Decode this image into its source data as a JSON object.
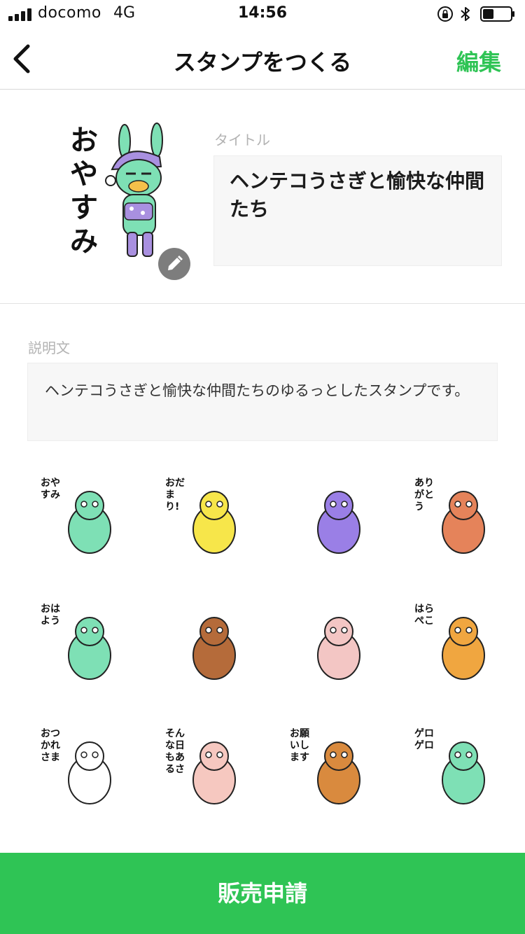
{
  "status_bar": {
    "carrier": "docomo",
    "network": "4G",
    "time": "14:56"
  },
  "nav": {
    "title": "スタンプをつくる",
    "edit_label": "編集",
    "back_icon": "chevron-left-icon"
  },
  "main_sticker": {
    "caption": "おやすみ",
    "edit_icon": "pencil-icon"
  },
  "title_section": {
    "label": "タイトル",
    "value": "ヘンテコうさぎと愉快な仲間たち"
  },
  "description_section": {
    "label": "説明文",
    "value": "ヘンテコうさぎと愉快な仲間たちのゆるっとしたスタンプです。"
  },
  "stickers": [
    {
      "caption": "おやすみ",
      "character": "rabbit"
    },
    {
      "caption": "おだまり!",
      "character": "chick"
    },
    {
      "caption": "",
      "character": "purple-rabbit"
    },
    {
      "caption": "ありがとう",
      "character": "owl"
    },
    {
      "caption": "おはよう",
      "character": "rabbit"
    },
    {
      "caption": "",
      "character": "dog"
    },
    {
      "caption": "",
      "character": "unicorn"
    },
    {
      "caption": "はらぺこ",
      "character": "lion"
    },
    {
      "caption": "おつかれさま",
      "character": "cow"
    },
    {
      "caption": "そんな日もあるさ",
      "character": "horse"
    },
    {
      "caption": "お願いします",
      "character": "squirrel"
    },
    {
      "caption": "ゲロゲロ",
      "character": "rabbit"
    }
  ],
  "cta": {
    "label": "販売申請"
  },
  "colors": {
    "accent": "#2fc455",
    "field_bg": "#f7f7f7",
    "label_gray": "#b3b3b3"
  }
}
